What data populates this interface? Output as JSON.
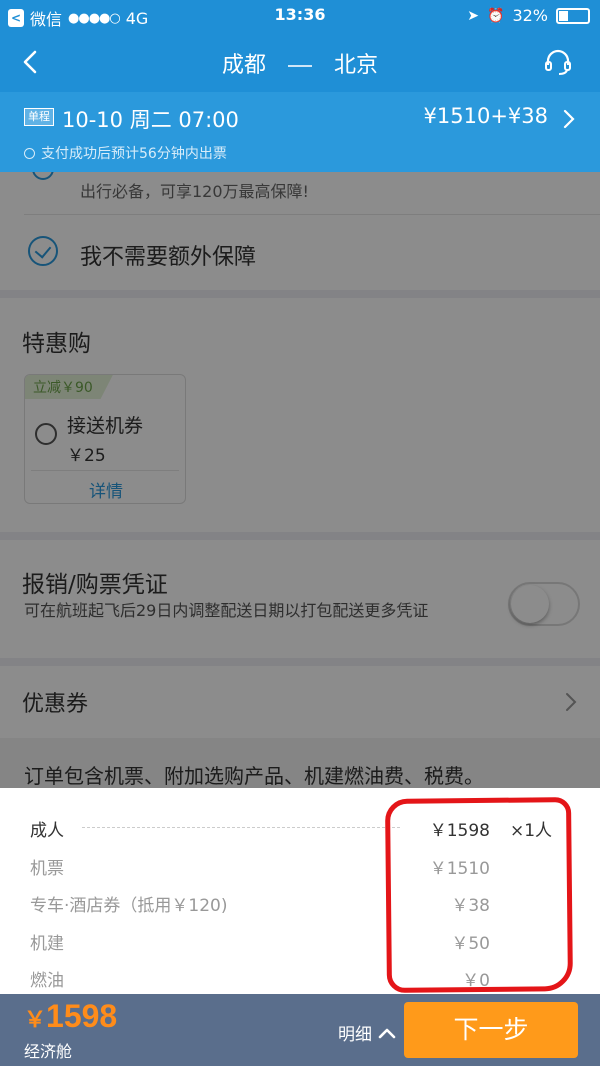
{
  "status_bar": {
    "app_back_label": "微信",
    "signal": "●●●●○",
    "network": "4G",
    "time": "13:36",
    "battery": "32%"
  },
  "nav": {
    "from": "成都",
    "to": "北京",
    "icons": [
      "back-icon",
      "headset-support-icon"
    ]
  },
  "trip": {
    "badge": "单程",
    "datetime": "10-10  周二 07:00",
    "price": "¥1510+¥38",
    "note": "支付成功后预计56分钟内出票"
  },
  "insurance": {
    "partial_text": "出行必备，可享120万最高保障!",
    "option_label": "我不需要额外保障",
    "option_selected": true
  },
  "deals": {
    "title": "特惠购",
    "item": {
      "tag": "立减￥90",
      "name": "接送机券",
      "price": "￥25",
      "detail_link": "详情",
      "selected": false
    }
  },
  "receipt": {
    "title": "报销/购票凭证",
    "description": "可在航班起飞后29日内调整配送日期以打包配送更多凭证",
    "toggle_on": false
  },
  "coupon": {
    "title": "优惠券"
  },
  "notice": {
    "text": "订单包含机票、附加选购产品、机建燃油费、税费。"
  },
  "breakdown": {
    "adult": {
      "label": "成人",
      "amount": "￥1598",
      "qty": "×1人"
    },
    "items": [
      {
        "label": "机票",
        "amount": "￥1510"
      },
      {
        "label": "专车·酒店券（抵用￥120)",
        "amount": "￥38"
      },
      {
        "label": "机建",
        "amount": "￥50"
      },
      {
        "label": "燃油",
        "amount": "￥0"
      }
    ]
  },
  "bottom": {
    "currency": "￥",
    "total": "1598",
    "cabin": "经济舱",
    "detail_label": "明细",
    "next_label": "下一步"
  },
  "colors": {
    "header_blue": "#1f8fd6",
    "accent_orange": "#ff9a1a",
    "bottom_bar": "#5a6e8c",
    "annotation_red": "#e41518"
  }
}
